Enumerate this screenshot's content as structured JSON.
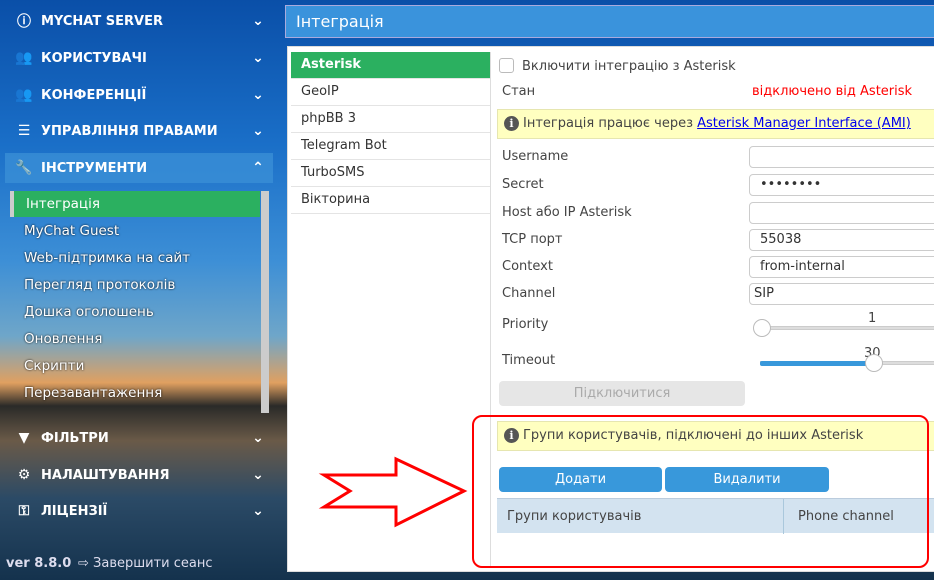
{
  "sidebar": {
    "nav": [
      {
        "label": "MYCHAT SERVER",
        "icon": "info-icon"
      },
      {
        "label": "КОРИСТУВАЧІ",
        "icon": "users-icon"
      },
      {
        "label": "КОНФЕРЕНЦІЇ",
        "icon": "users-icon"
      },
      {
        "label": "УПРАВЛІННЯ ПРАВАМИ",
        "icon": "list-icon"
      },
      {
        "label": "ІНСТРУМЕНТИ",
        "icon": "wrench-icon"
      },
      {
        "label": "ФІЛЬТРИ",
        "icon": "filter-icon"
      },
      {
        "label": "НАЛАШТУВАННЯ",
        "icon": "gears-icon"
      },
      {
        "label": "ЛІЦЕНЗІЇ",
        "icon": "key-icon"
      }
    ],
    "tools_sub": [
      "Інтеграція",
      "MyChat Guest",
      "Web-підтримка на сайт",
      "Перегляд протоколів",
      "Дошка оголошень",
      "Оновлення",
      "Скрипти",
      "Перезавантаження"
    ],
    "version": "ver 8.8.0",
    "logout": "Завершити сеанс"
  },
  "page": {
    "title": "Інтеграція"
  },
  "tabs": [
    "Asterisk",
    "GeoIP",
    "phpBB 3",
    "Telegram Bot",
    "TurboSMS",
    "Вікторина"
  ],
  "form": {
    "enable_label": "Включити інтеграцію з Asterisk",
    "enable_checked": false,
    "state_label": "Стан",
    "state_value": "відключено від Asterisk",
    "state_color": "#ff0000",
    "note_text": "Інтеграція працює через ",
    "note_link": "Asterisk Manager Interface (AMI)",
    "fields": [
      {
        "label": "Username",
        "value": ""
      },
      {
        "label": "Secret",
        "value": "••••••••"
      },
      {
        "label": "Host або IP Asterisk",
        "value": ""
      },
      {
        "label": "TCP порт",
        "value": "55038"
      },
      {
        "label": "Context",
        "value": "from-internal"
      },
      {
        "label": "Channel",
        "value": "SIP"
      }
    ],
    "priority_label": "Priority",
    "priority_value": "1",
    "timeout_label": "Timeout",
    "timeout_value": "30",
    "connect_label": "Підключитися"
  },
  "groups": {
    "note": "Групи користувачів, підключені до інших Asterisk",
    "add_label": "Додати",
    "delete_label": "Видалити",
    "columns": [
      "Групи користувачів",
      "Phone channel"
    ]
  },
  "colors": {
    "accent": "#3898db",
    "selected": "#2bb060",
    "annotation": "#ff0000"
  }
}
